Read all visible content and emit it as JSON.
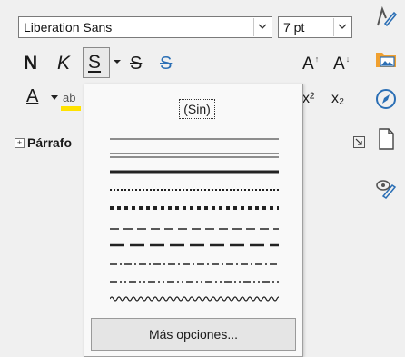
{
  "font_name": {
    "value": "Liberation Sans"
  },
  "font_size": {
    "value": "7 pt"
  },
  "toolbar": {
    "bold": "N",
    "italic": "K",
    "underline": "S",
    "strikethrough": "S",
    "shadow": "S",
    "grow": "A",
    "shrink": "A",
    "font_color": "A",
    "highlight": "ab",
    "superscript": "x²",
    "subscript": "x₂"
  },
  "section": {
    "title": "Párrafo",
    "expander": "+"
  },
  "underline_menu": {
    "none_label": "(Sin)",
    "styles": [
      "single",
      "double",
      "bold",
      "dotted",
      "dotted-bold",
      "dash",
      "dash-long",
      "dash-dot",
      "dash-dot-dot",
      "wave"
    ],
    "more_options": "Más opciones..."
  },
  "colors": {
    "accent": "#2b6fb5",
    "highlight": "#ffe200",
    "folder": "#f0a030"
  },
  "icons": [
    "combo-arrow",
    "underline-dropdown-arrow",
    "grow-arrow",
    "shrink-arrow",
    "properties-icon",
    "gallery-icon",
    "navigator-icon",
    "page-icon",
    "style-inspector-icon",
    "more-options-icon"
  ]
}
